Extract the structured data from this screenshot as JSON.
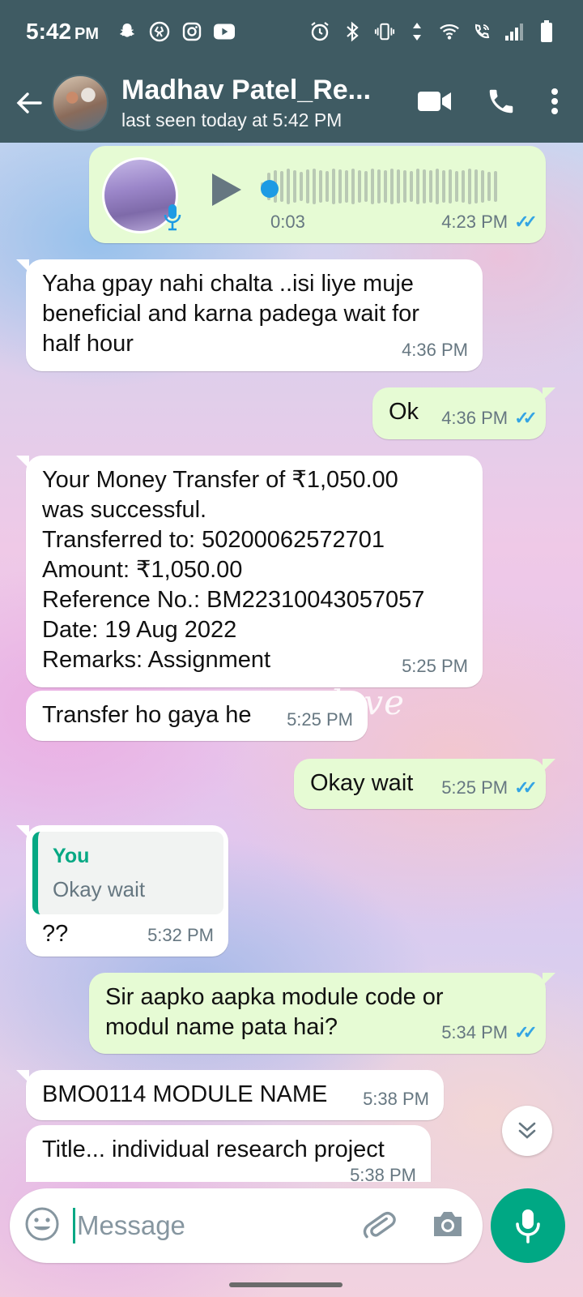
{
  "status_bar": {
    "time": "5:42",
    "ampm": "PM",
    "left_icons": [
      "snapchat-icon",
      "shazam-icon",
      "instagram-icon",
      "youtube-icon"
    ],
    "right_icons": [
      "alarm-icon",
      "bluetooth-icon",
      "vibrate-icon",
      "data-icon",
      "wifi-icon",
      "wifi-call-icon",
      "signal-icon",
      "battery-icon"
    ]
  },
  "header": {
    "contact_name": "Madhav Patel_Re...",
    "last_seen": "last seen today at 5:42 PM"
  },
  "messages": [
    {
      "type": "voice",
      "direction": "out",
      "duration": "0:03",
      "time": "4:23 PM",
      "read": true
    },
    {
      "type": "text",
      "direction": "in",
      "lines": [
        "Yaha gpay nahi chalta ..isi liye muje",
        "beneficial and karna padega wait for",
        "half hour"
      ],
      "time": "4:36 PM"
    },
    {
      "type": "text",
      "direction": "out",
      "lines": [
        "Ok"
      ],
      "time": "4:36 PM",
      "read": true
    },
    {
      "type": "text",
      "direction": "in",
      "lines": [
        "Your Money Transfer of ₹1,050.00",
        "was successful.",
        "Transferred to: 50200062572701",
        "Amount: ₹1,050.00",
        "Reference No.: BM22310043057057",
        "Date: 19 Aug 2022",
        "Remarks: Assignment"
      ],
      "time": "5:25 PM"
    },
    {
      "type": "text",
      "direction": "in",
      "lines": [
        "Transfer ho gaya he"
      ],
      "time": "5:25 PM"
    },
    {
      "type": "text",
      "direction": "out",
      "lines": [
        "Okay wait"
      ],
      "time": "5:25 PM",
      "read": true
    },
    {
      "type": "reply",
      "direction": "in",
      "quote_author": "You",
      "quote_text": "Okay wait",
      "lines": [
        "??"
      ],
      "time": "5:32 PM"
    },
    {
      "type": "text",
      "direction": "out",
      "lines": [
        "Sir aapko aapka module code or",
        "modul name pata hai?"
      ],
      "time": "5:34 PM",
      "read": true
    },
    {
      "type": "text",
      "direction": "in",
      "lines": [
        "BMO0114 MODULE NAME"
      ],
      "time": "5:38 PM"
    },
    {
      "type": "text",
      "direction": "in",
      "lines": [
        "Title... individual research project"
      ],
      "time": "5:38 PM"
    }
  ],
  "wallpaper_text": "ou love",
  "composer": {
    "placeholder": "Message"
  },
  "colors": {
    "header": "#3f5b63",
    "accent": "#00a884",
    "outgoing_bubble": "#e6fbd4",
    "read_ticks": "#34a4e4"
  }
}
